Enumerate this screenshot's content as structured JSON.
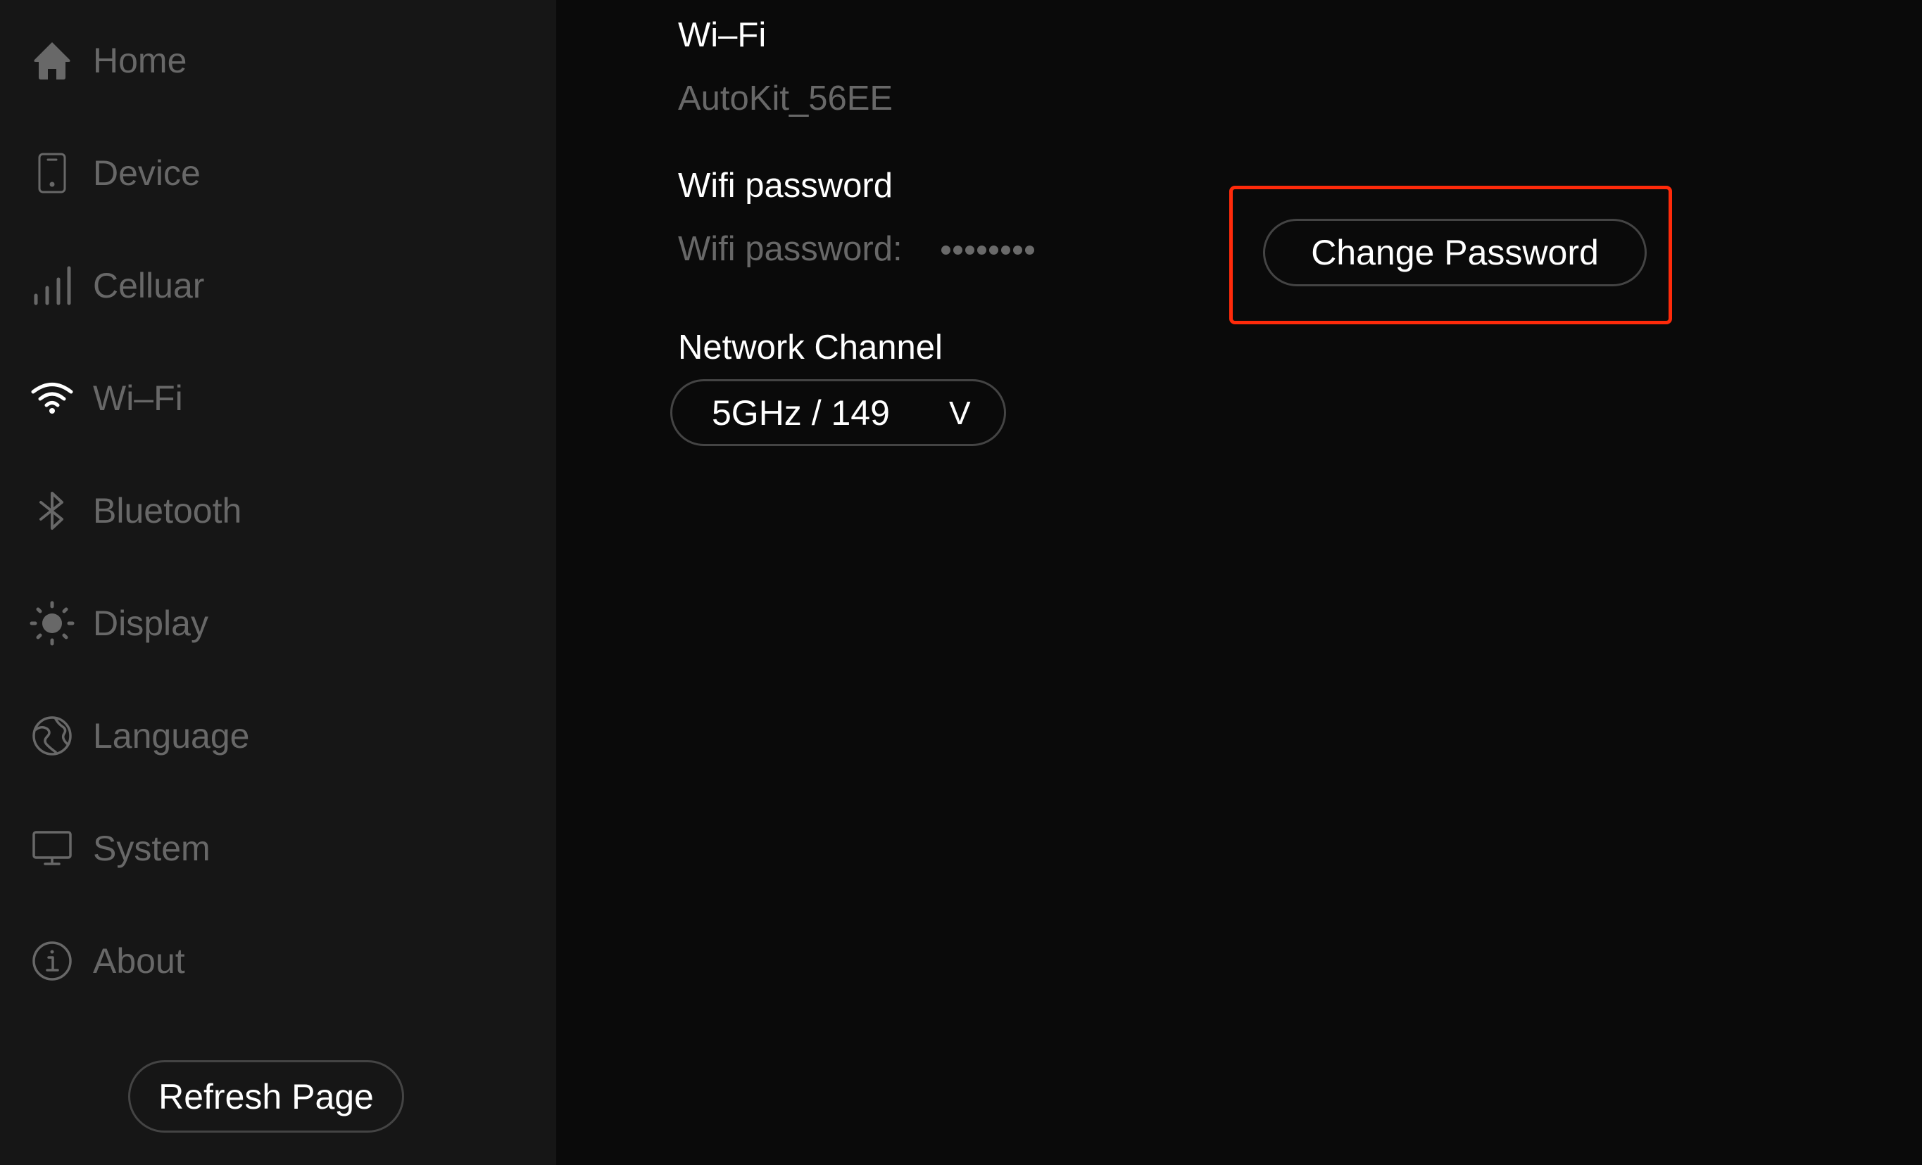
{
  "sidebar": {
    "items": [
      {
        "id": "home",
        "label": "Home",
        "icon": "home-icon",
        "active": false
      },
      {
        "id": "device",
        "label": "Device",
        "icon": "phone-icon",
        "active": false
      },
      {
        "id": "cellular",
        "label": "Celluar",
        "icon": "signal-bars-icon",
        "active": false
      },
      {
        "id": "wifi",
        "label": "Wi–Fi",
        "icon": "wifi-icon",
        "active": true
      },
      {
        "id": "bluetooth",
        "label": "Bluetooth",
        "icon": "bluetooth-icon",
        "active": false
      },
      {
        "id": "display",
        "label": "Display",
        "icon": "sun-icon",
        "active": false
      },
      {
        "id": "language",
        "label": "Language",
        "icon": "globe-icon",
        "active": false
      },
      {
        "id": "system",
        "label": "System",
        "icon": "monitor-icon",
        "active": false
      },
      {
        "id": "about",
        "label": "About",
        "icon": "info-icon",
        "active": false
      }
    ],
    "refresh_label": "Refresh Page"
  },
  "main": {
    "wifi": {
      "heading": "Wi–Fi",
      "ssid": "AutoKit_56EE"
    },
    "password": {
      "heading": "Wifi password",
      "label": "Wifi password:",
      "masked_length": 8,
      "change_button_label": "Change Password"
    },
    "channel": {
      "heading": "Network Channel",
      "selected": "5GHz / 149",
      "caret": "V"
    }
  },
  "colors": {
    "sidebar_bg": "#161616",
    "main_bg": "#0a0a0a",
    "text_primary": "#ffffff",
    "text_muted": "#686868",
    "border": "#444444",
    "highlight": "#ff2a0a",
    "active_icon": "#ffffff"
  }
}
